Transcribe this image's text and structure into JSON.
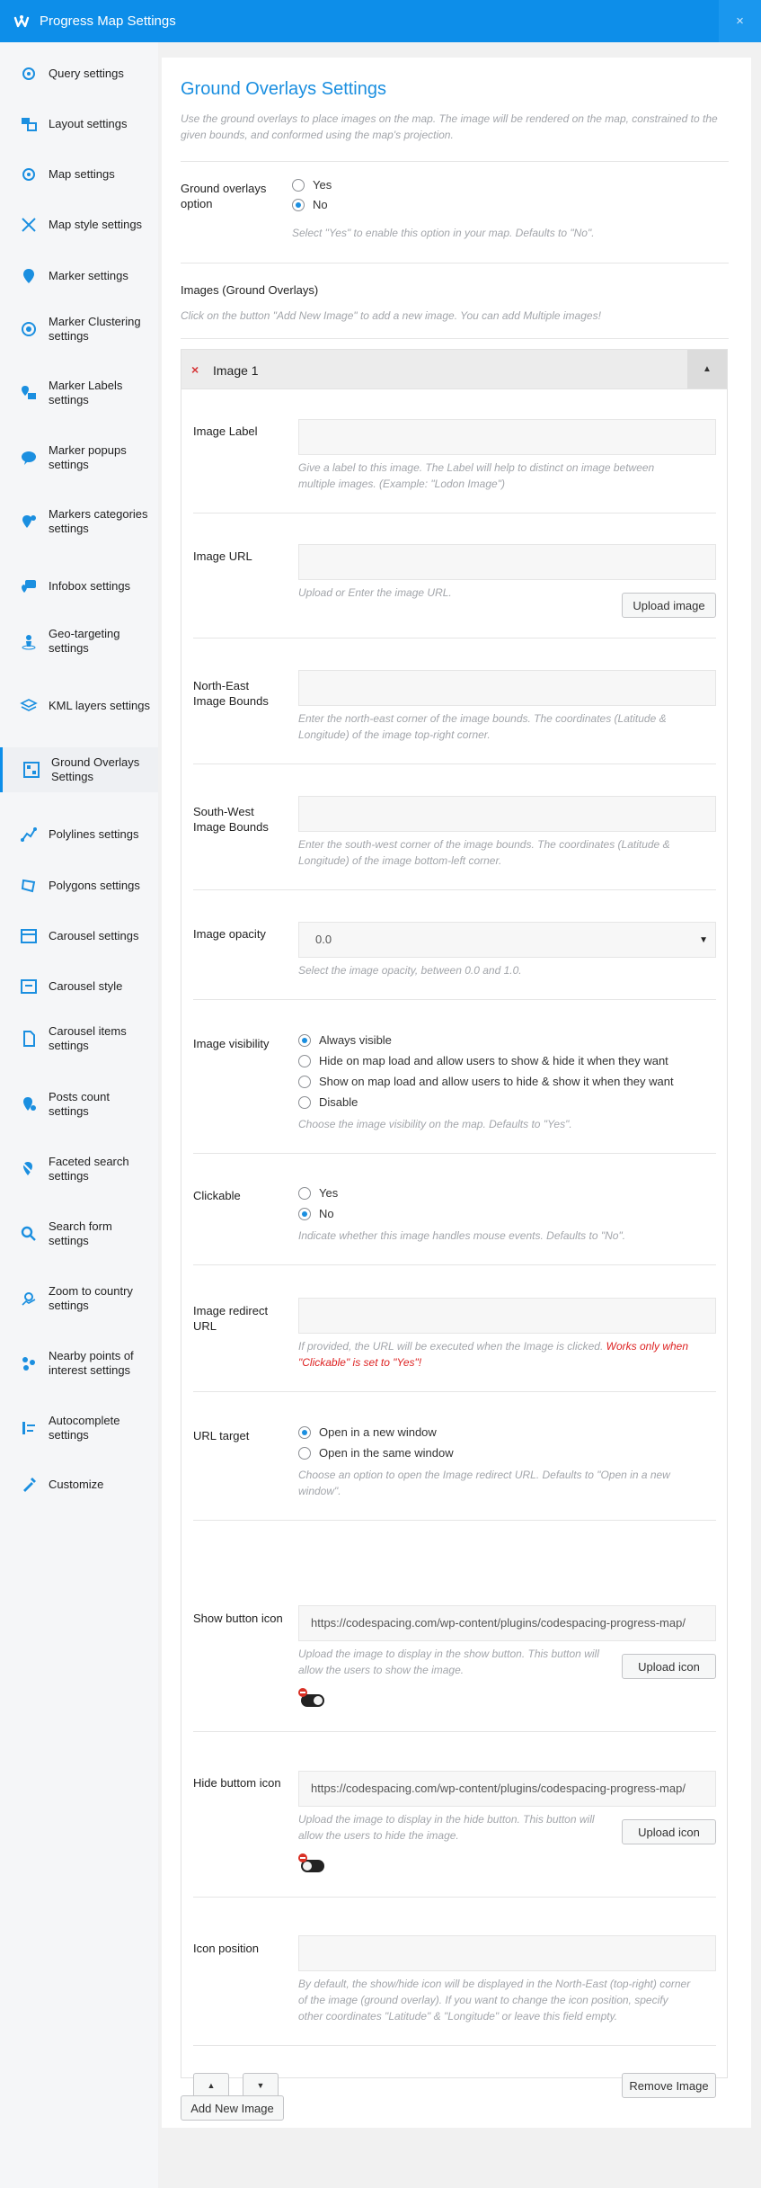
{
  "app": {
    "title": "Progress Map Settings",
    "close": "×"
  },
  "sidebar": {
    "items": [
      {
        "label": "Query settings",
        "icon": "gear-icon"
      },
      {
        "label": "Layout settings",
        "icon": "layout-icon"
      },
      {
        "label": "Map settings",
        "icon": "gear-icon"
      },
      {
        "label": "Map style settings",
        "icon": "brush-icon"
      },
      {
        "label": "Marker settings",
        "icon": "marker-icon"
      },
      {
        "label": "Marker Clustering settings",
        "icon": "cluster-icon"
      },
      {
        "label": "Marker Labels settings",
        "icon": "marker-label-icon"
      },
      {
        "label": "Marker popups settings",
        "icon": "popup-icon"
      },
      {
        "label": "Markers categories settings",
        "icon": "categories-icon"
      },
      {
        "label": "Infobox settings",
        "icon": "infobox-icon"
      },
      {
        "label": "Geo-targeting settings",
        "icon": "geotarget-icon"
      },
      {
        "label": "KML layers settings",
        "icon": "layers-icon"
      },
      {
        "label": "Ground Overlays Settings",
        "icon": "overlay-icon"
      },
      {
        "label": "Polylines settings",
        "icon": "polyline-icon"
      },
      {
        "label": "Polygons settings",
        "icon": "polygon-icon"
      },
      {
        "label": "Carousel settings",
        "icon": "carousel-icon"
      },
      {
        "label": "Carousel style",
        "icon": "carousel-style-icon"
      },
      {
        "label": "Carousel items settings",
        "icon": "document-icon"
      },
      {
        "label": "Posts count settings",
        "icon": "count-pin-icon"
      },
      {
        "label": "Faceted search settings",
        "icon": "faceted-pin-icon"
      },
      {
        "label": "Search form settings",
        "icon": "search-icon"
      },
      {
        "label": "Zoom to country settings",
        "icon": "zoom-country-icon"
      },
      {
        "label": "Nearby points of interest settings",
        "icon": "nearby-icon"
      },
      {
        "label": "Autocomplete settings",
        "icon": "autocomplete-icon"
      },
      {
        "label": "Customize",
        "icon": "customize-icon"
      }
    ],
    "active_index": 12
  },
  "main": {
    "title": "Ground Overlays Settings",
    "intro": "Use the ground overlays to place images on the map. The image will be rendered on the map, constrained to the given bounds, and conformed using the map's projection.",
    "option": {
      "label": "Ground overlays option",
      "yes": "Yes",
      "no": "No",
      "selected": "No",
      "desc": "Select \"Yes\" to enable this option in your map. Defaults to \"No\"."
    },
    "images_title": "Images (Ground Overlays)",
    "images_desc": "Click on the button \"Add New Image\" to add a new image. You can add Multiple images!",
    "image": {
      "header": "Image 1",
      "remove_mark": "×",
      "toggle": "▲",
      "label_field": {
        "label": "Image Label",
        "value": "",
        "desc": "Give a label to this image. The Label will help to distinct on image between multiple images. (Example: \"Lodon Image\")"
      },
      "url_field": {
        "label": "Image URL",
        "value": "",
        "desc": "Upload or Enter the image URL.",
        "button": "Upload image"
      },
      "ne_field": {
        "label": "North-East Image Bounds",
        "value": "",
        "desc": "Enter the north-east corner of the image bounds. The coordinates (Latitude & Longitude) of the image top-right corner."
      },
      "sw_field": {
        "label": "South-West Image Bounds",
        "value": "",
        "desc": "Enter the south-west corner of the image bounds. The coordinates (Latitude & Longitude) of the image bottom-left corner."
      },
      "opacity_field": {
        "label": "Image opacity",
        "value": "0.0",
        "desc": "Select the image opacity, between 0.0 and 1.0."
      },
      "visibility_field": {
        "label": "Image visibility",
        "options": [
          "Always visible",
          "Hide on map load and allow users to show & hide it when they want",
          "Show on map load and allow users to hide & show it when they want",
          "Disable"
        ],
        "selected": "Always visible",
        "desc": "Choose the image visibility on the map. Defaults to \"Yes\"."
      },
      "clickable_field": {
        "label": "Clickable",
        "yes": "Yes",
        "no": "No",
        "selected": "No",
        "desc": "Indicate whether this image handles mouse events. Defaults to \"No\"."
      },
      "redirect_field": {
        "label": "Image redirect URL",
        "value": "",
        "desc": "If provided, the URL will be executed when the Image is clicked.",
        "warn": "Works only when \"Clickable\" is set to \"Yes\"!"
      },
      "target_field": {
        "label": "URL target",
        "options": [
          "Open in a new window",
          "Open in the same window"
        ],
        "selected": "Open in a new window",
        "desc": "Choose an option to open the Image redirect URL. Defaults to \"Open in a new window\"."
      },
      "show_icon_field": {
        "label": "Show button icon",
        "value": "https://codespacing.com/wp-content/plugins/codespacing-progress-map/",
        "desc": "Upload the image to display in the show button. This button will allow the users to show the image.",
        "button": "Upload icon"
      },
      "hide_icon_field": {
        "label": "Hide buttom icon",
        "value": "https://codespacing.com/wp-content/plugins/codespacing-progress-map/",
        "desc": "Upload the image to display in the hide button. This button will allow the users to hide the image.",
        "button": "Upload icon"
      },
      "position_field": {
        "label": "Icon position",
        "value": "",
        "desc": "By default, the show/hide icon will be displayed in the North-East (top-right) corner of the image (ground overlay). If you want to change the icon position, specify other coordinates \"Latitude\" & \"Longitude\" or leave this field empty."
      },
      "move_up": "▲",
      "move_down": "▼",
      "remove_button": "Remove Image"
    },
    "add_button": "Add New Image"
  },
  "colors": {
    "accent": "#0d8ee9",
    "title": "#1b8fe0",
    "warn": "#dd2222"
  }
}
